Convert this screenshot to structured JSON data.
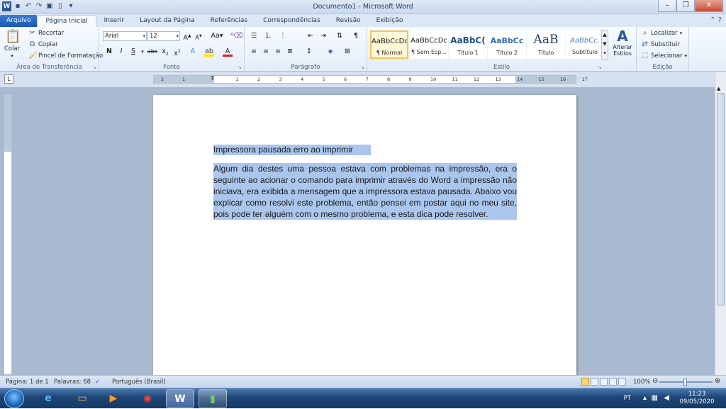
{
  "window": {
    "title": "Documento1 - Microsoft Word"
  },
  "tabs": [
    {
      "label": "Arquivo"
    },
    {
      "label": "Página Inicial"
    },
    {
      "label": "Inserir"
    },
    {
      "label": "Layout da Página"
    },
    {
      "label": "Referências"
    },
    {
      "label": "Correspondências"
    },
    {
      "label": "Revisão"
    },
    {
      "label": "Exibição"
    }
  ],
  "clipboard": {
    "paste_label": "Colar",
    "cut_label": "Recortar",
    "copy_label": "Copiar",
    "format_painter_label": "Pincel de Formatação",
    "group_label": "Área de Transferência"
  },
  "font": {
    "font_name": "Arial",
    "font_size": "12",
    "group_label": "Fonte"
  },
  "paragraph": {
    "group_label": "Parágrafo"
  },
  "styles": {
    "items": [
      {
        "sample": "AaBbCcDc",
        "name": "¶ Normal"
      },
      {
        "sample": "AaBbCcDc",
        "name": "¶ Sem Esp..."
      },
      {
        "sample": "AaBbC(",
        "name": "Título 1"
      },
      {
        "sample": "AaBbCc",
        "name": "Título 2"
      },
      {
        "sample": "AaB",
        "name": "Título"
      },
      {
        "sample": "AaBbCc.",
        "name": "Subtítulo"
      }
    ],
    "change_styles_label": "Alterar Estilos",
    "group_label": "Estilo"
  },
  "editing": {
    "find_label": "Localizar",
    "replace_label": "Substituir",
    "select_label": "Selecionar",
    "group_label": "Edição"
  },
  "ruler": {
    "numbers": [
      "1",
      "2",
      "1",
      "2",
      "3",
      "4",
      "5",
      "6",
      "7",
      "8",
      "9",
      "10",
      "11",
      "12",
      "13",
      "14",
      "15",
      "16",
      "17"
    ]
  },
  "document": {
    "title": "Impressora  pausada erro ao imprimir",
    "paragraph": "Algum dia destes uma pessoa estava com problemas na impressão, era o seguinte ao acionar o comando para imprimir através do Word a impressão não iniciava, era exibida a mensagem que a impressora estava pausada. Abaixo vou explicar como resolvi este problema, então pensei em postar aqui no meu site, pois pode ter alguém com o mesmo problema, e esta dica pode resolver."
  },
  "status": {
    "page": "Página: 1 de 1",
    "words": "Palavras: 68",
    "language": "Português (Brasil)",
    "zoom": "100%"
  },
  "taskbar": {
    "lang": "PT",
    "time": "11:23",
    "date": "09/05/2020"
  }
}
